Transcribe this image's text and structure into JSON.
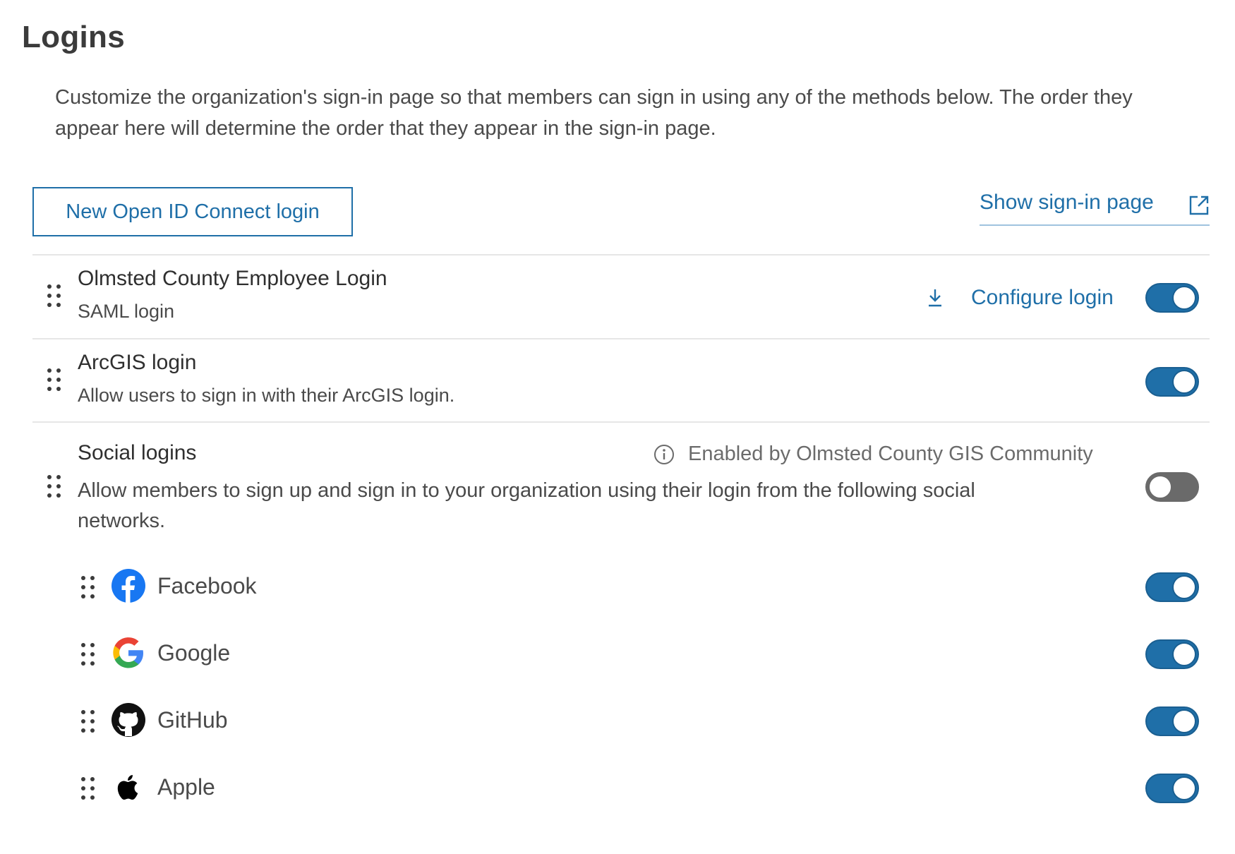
{
  "header": {
    "title": "Logins",
    "description": "Customize the organization's sign-in page so that members can sign in using any of the methods below. The order they appear here will determine the order that they appear in the sign-in page."
  },
  "toolbar": {
    "new_oidc_label": "New Open ID Connect login",
    "show_signin_label": "Show sign-in page"
  },
  "logins": [
    {
      "title": "Olmsted County Employee Login",
      "subtitle": "SAML login",
      "action_label": "Configure login",
      "enabled": true,
      "icon": "download-icon"
    },
    {
      "title": "ArcGIS login",
      "subtitle": "Allow users to sign in with their ArcGIS login.",
      "enabled": true
    },
    {
      "title": "Social logins",
      "subtitle": "Allow members to sign up and sign in to your organization using their login from the following social networks.",
      "note": "Enabled by Olmsted County GIS Community",
      "enabled": false,
      "icon": "info-icon"
    }
  ],
  "social": [
    {
      "name": "Facebook",
      "icon": "facebook-icon",
      "enabled": true
    },
    {
      "name": "Google",
      "icon": "google-icon",
      "enabled": true
    },
    {
      "name": "GitHub",
      "icon": "github-icon",
      "enabled": true
    },
    {
      "name": "Apple",
      "icon": "apple-icon",
      "enabled": true
    }
  ],
  "colors": {
    "accent": "#1f6fa8",
    "toggle_off": "#6a6a6a",
    "text": "#323232"
  }
}
